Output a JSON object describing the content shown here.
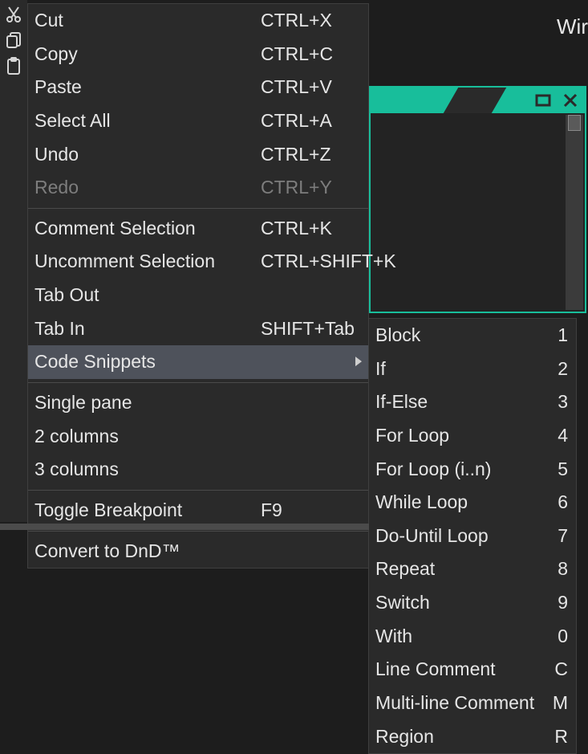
{
  "topRight": "Wir",
  "gutterIcons": [
    "cut-icon",
    "copy-icon",
    "paste-icon"
  ],
  "mainMenu": {
    "groups": [
      [
        {
          "id": "cut",
          "label": "Cut",
          "shortcut": "CTRL+X"
        },
        {
          "id": "copy",
          "label": "Copy",
          "shortcut": "CTRL+C"
        },
        {
          "id": "paste",
          "label": "Paste",
          "shortcut": "CTRL+V"
        },
        {
          "id": "select-all",
          "label": "Select All",
          "shortcut": "CTRL+A"
        },
        {
          "id": "undo",
          "label": "Undo",
          "shortcut": "CTRL+Z"
        },
        {
          "id": "redo",
          "label": "Redo",
          "shortcut": "CTRL+Y",
          "disabled": true
        }
      ],
      [
        {
          "id": "comment",
          "label": "Comment Selection",
          "shortcut": "CTRL+K"
        },
        {
          "id": "uncomment",
          "label": "Uncomment Selection",
          "shortcut": "CTRL+SHIFT+K"
        },
        {
          "id": "tab-out",
          "label": "Tab Out",
          "shortcut": ""
        },
        {
          "id": "tab-in",
          "label": "Tab In",
          "shortcut": "SHIFT+Tab"
        },
        {
          "id": "snippets",
          "label": "Code Snippets",
          "shortcut": "",
          "submenu": true,
          "highlight": true
        }
      ],
      [
        {
          "id": "pane1",
          "label": "Single pane",
          "shortcut": ""
        },
        {
          "id": "pane2",
          "label": "2 columns",
          "shortcut": ""
        },
        {
          "id": "pane3",
          "label": "3 columns",
          "shortcut": ""
        }
      ],
      [
        {
          "id": "breakpoint",
          "label": "Toggle Breakpoint",
          "shortcut": "F9"
        }
      ],
      [
        {
          "id": "dnd",
          "label": "Convert to DnD™",
          "shortcut": ""
        }
      ]
    ]
  },
  "subMenu": {
    "items": [
      {
        "id": "block",
        "label": "Block",
        "shortcut": "1"
      },
      {
        "id": "if",
        "label": "If",
        "shortcut": "2"
      },
      {
        "id": "ifelse",
        "label": "If-Else",
        "shortcut": "3"
      },
      {
        "id": "for",
        "label": "For Loop",
        "shortcut": "4"
      },
      {
        "id": "forn",
        "label": "For Loop (i..n)",
        "shortcut": "5"
      },
      {
        "id": "while",
        "label": "While Loop",
        "shortcut": "6"
      },
      {
        "id": "dountil",
        "label": "Do-Until Loop",
        "shortcut": "7"
      },
      {
        "id": "repeat",
        "label": "Repeat",
        "shortcut": "8"
      },
      {
        "id": "switch",
        "label": "Switch",
        "shortcut": "9"
      },
      {
        "id": "with",
        "label": "With",
        "shortcut": "0"
      },
      {
        "id": "lcomment",
        "label": "Line Comment",
        "shortcut": "C"
      },
      {
        "id": "mcomment",
        "label": "Multi-line Comment",
        "shortcut": "M"
      },
      {
        "id": "region",
        "label": "Region",
        "shortcut": "R"
      }
    ]
  }
}
